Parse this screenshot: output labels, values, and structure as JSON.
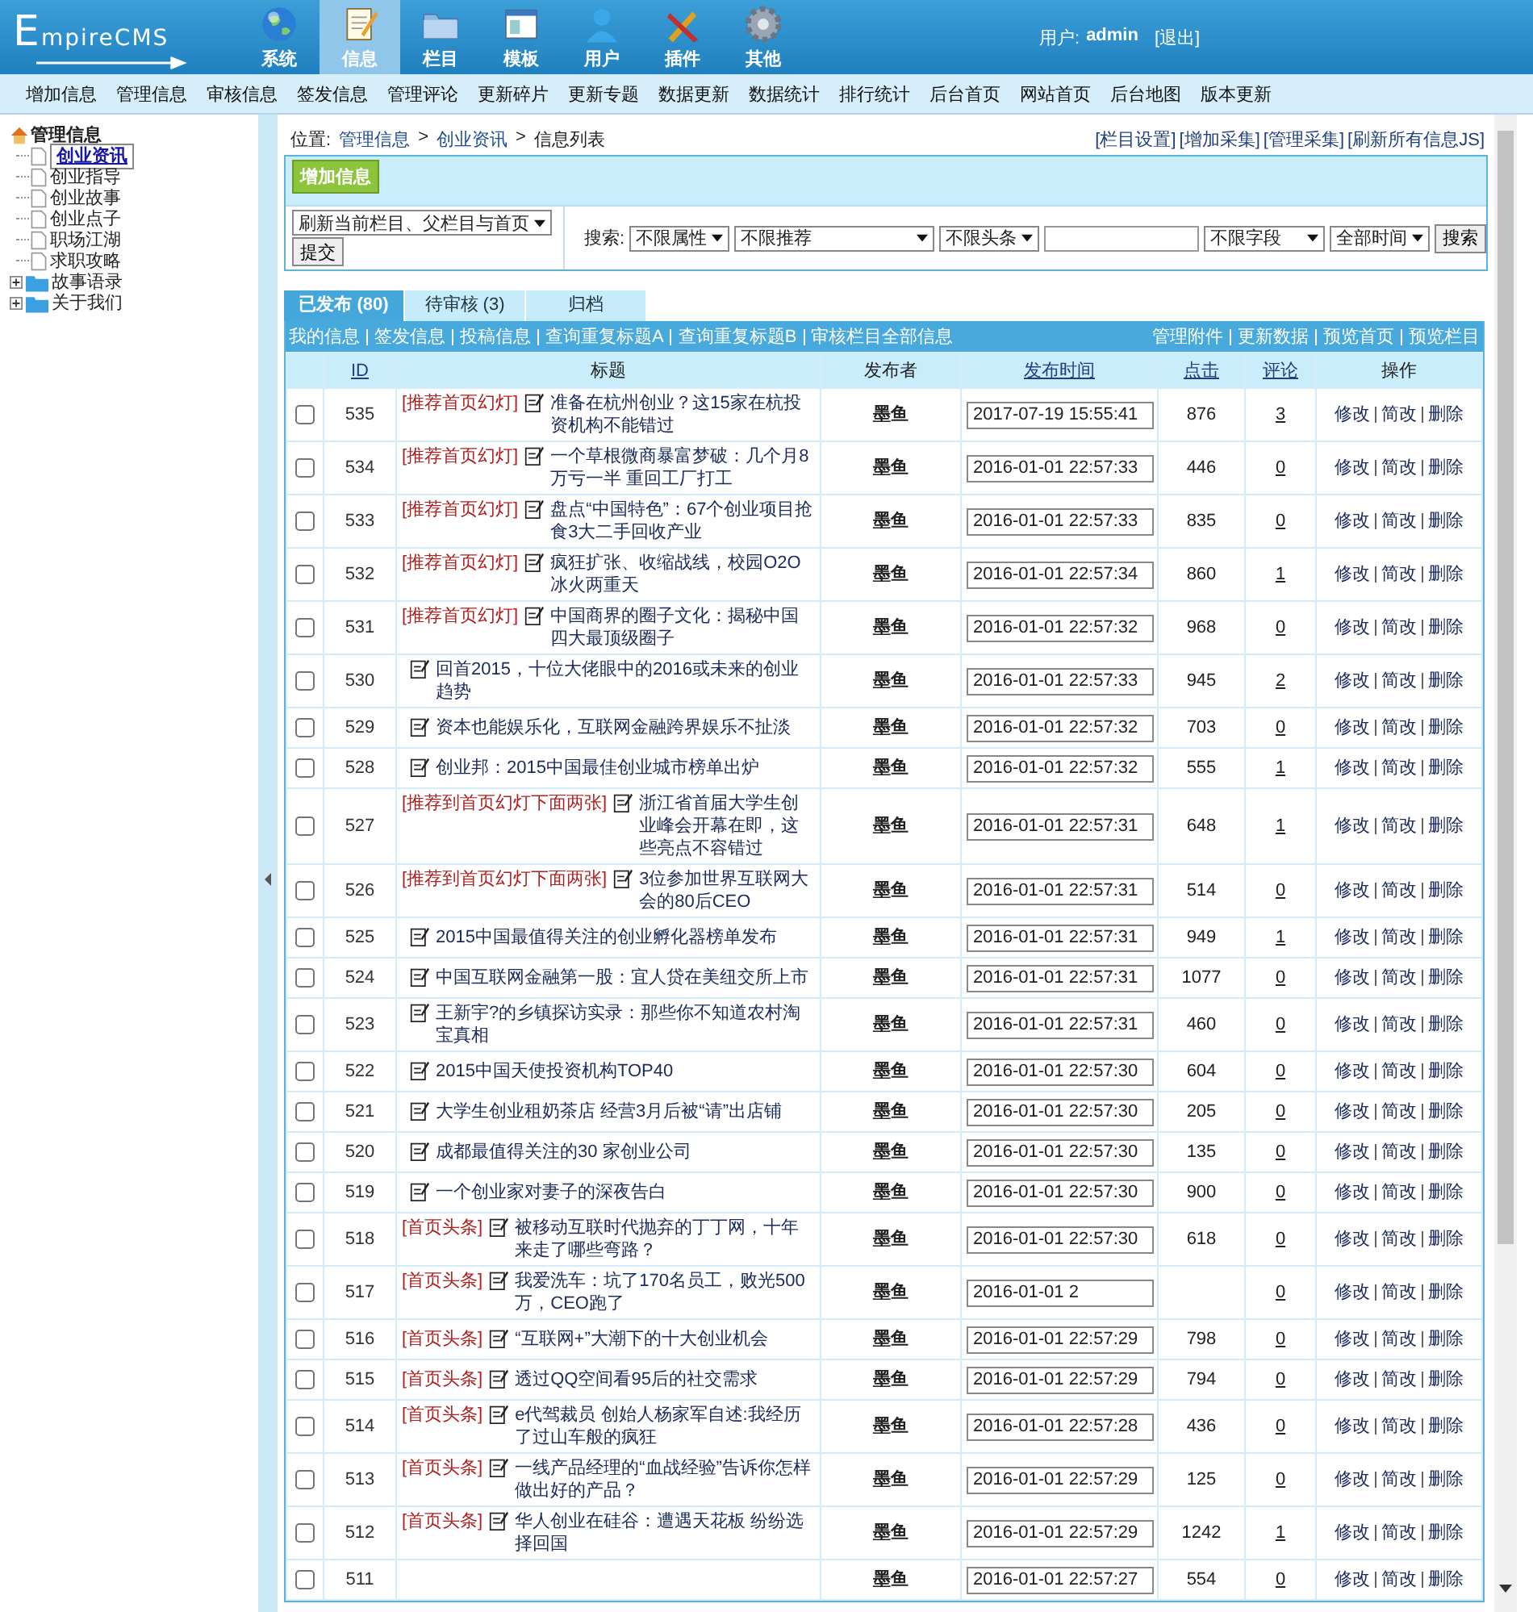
{
  "header": {
    "logo": "EmpireCMS",
    "nav": [
      {
        "label": "系统",
        "selected": false
      },
      {
        "label": "信息",
        "selected": true
      },
      {
        "label": "栏目",
        "selected": false
      },
      {
        "label": "模板",
        "selected": false
      },
      {
        "label": "用户",
        "selected": false
      },
      {
        "label": "插件",
        "selected": false
      },
      {
        "label": "其他",
        "selected": false
      }
    ],
    "user_label": "用户:",
    "user": "admin",
    "logout": "[退出]"
  },
  "menu": [
    "增加信息",
    "管理信息",
    "审核信息",
    "签发信息",
    "管理评论",
    "更新碎片",
    "更新专题",
    "数据更新",
    "数据统计",
    "排行统计",
    "后台首页",
    "网站首页",
    "后台地图",
    "版本更新"
  ],
  "sidebar": {
    "root": "管理信息",
    "children": [
      {
        "label": "创业资讯",
        "selected": true
      },
      {
        "label": "创业指导",
        "selected": false
      },
      {
        "label": "创业故事",
        "selected": false
      },
      {
        "label": "创业点子",
        "selected": false
      },
      {
        "label": "职场江湖",
        "selected": false
      },
      {
        "label": "求职攻略",
        "selected": false
      }
    ],
    "folders": [
      {
        "label": "故事语录",
        "expanded": false
      },
      {
        "label": "关于我们",
        "expanded": false
      }
    ]
  },
  "breadcrumb": {
    "label": "位置:",
    "path": [
      "管理信息",
      "创业资讯",
      "信息列表"
    ],
    "separator": ">"
  },
  "top_links": [
    "[栏目设置]",
    "[增加采集]",
    "[管理采集]",
    "[刷新所有信息JS]"
  ],
  "toolbar": {
    "add_button": "增加信息",
    "refresh_select": "刷新当前栏目、父栏目与首页",
    "submit": "提交",
    "search_label": "搜索:",
    "filters": [
      "不限属性",
      "不限推荐",
      "不限头条"
    ],
    "field_select": "不限字段",
    "time_select": "全部时间",
    "search_button": "搜索"
  },
  "tabs": [
    {
      "label": "已发布 (80)",
      "selected": true
    },
    {
      "label": "待审核 (3)",
      "selected": false
    },
    {
      "label": "归档",
      "selected": false
    }
  ],
  "links_left": [
    "我的信息",
    "签发信息",
    "投稿信息",
    "查询重复标题A",
    "查询重复标题B",
    "审核栏目全部信息"
  ],
  "links_right": [
    "管理附件",
    "更新数据",
    "预览首页",
    "预览栏目"
  ],
  "table": {
    "columns": [
      {
        "label": "ID",
        "sortable": true
      },
      {
        "label": "标题",
        "sortable": false
      },
      {
        "label": "发布者",
        "sortable": false
      },
      {
        "label": "发布时间",
        "sortable": true
      },
      {
        "label": "点击",
        "sortable": true
      },
      {
        "label": "评论",
        "sortable": true
      },
      {
        "label": "操作",
        "sortable": false
      }
    ],
    "rows": [
      {
        "checked": false,
        "id": "535",
        "tag": "[推荐首页幻灯]",
        "title": "准备在杭州创业？这15家在杭投资机构不能错过",
        "publisher": "墨鱼",
        "time": "2017-07-19 15:55:41",
        "clicks": "876",
        "comments": "3",
        "actions": [
          "修改",
          "简改",
          "删除"
        ]
      },
      {
        "checked": false,
        "id": "534",
        "tag": "[推荐首页幻灯]",
        "title": "一个草根微商暴富梦破：几个月8万亏一半 重回工厂打工",
        "publisher": "墨鱼",
        "time": "2016-01-01 22:57:33",
        "clicks": "446",
        "comments": "0",
        "actions": [
          "修改",
          "简改",
          "删除"
        ]
      },
      {
        "checked": false,
        "id": "533",
        "tag": "[推荐首页幻灯]",
        "title": "盘点“中国特色”：67个创业项目抢食3大二手回收产业",
        "publisher": "墨鱼",
        "time": "2016-01-01 22:57:33",
        "clicks": "835",
        "comments": "0",
        "actions": [
          "修改",
          "简改",
          "删除"
        ]
      },
      {
        "checked": false,
        "id": "532",
        "tag": "[推荐首页幻灯]",
        "title": "疯狂扩张、收缩战线，校园O2O冰火两重天",
        "publisher": "墨鱼",
        "time": "2016-01-01 22:57:34",
        "clicks": "860",
        "comments": "1",
        "actions": [
          "修改",
          "简改",
          "删除"
        ]
      },
      {
        "checked": false,
        "id": "531",
        "tag": "[推荐首页幻灯]",
        "title": "中国商界的圈子文化：揭秘中国四大最顶级圈子",
        "publisher": "墨鱼",
        "time": "2016-01-01 22:57:32",
        "clicks": "968",
        "comments": "0",
        "actions": [
          "修改",
          "简改",
          "删除"
        ]
      },
      {
        "checked": false,
        "id": "530",
        "title": "回首2015，十位大佬眼中的2016或未来的创业趋势",
        "publisher": "墨鱼",
        "time": "2016-01-01 22:57:33",
        "clicks": "945",
        "comments": "2",
        "actions": [
          "修改",
          "简改",
          "删除"
        ]
      },
      {
        "checked": false,
        "id": "529",
        "title": "资本也能娱乐化，互联网金融跨界娱乐不扯淡",
        "publisher": "墨鱼",
        "time": "2016-01-01 22:57:32",
        "clicks": "703",
        "comments": "0",
        "actions": [
          "修改",
          "简改",
          "删除"
        ]
      },
      {
        "checked": false,
        "id": "528",
        "title": "创业邦：2015中国最佳创业城市榜单出炉",
        "publisher": "墨鱼",
        "time": "2016-01-01 22:57:32",
        "clicks": "555",
        "comments": "1",
        "actions": [
          "修改",
          "简改",
          "删除"
        ]
      },
      {
        "checked": false,
        "id": "527",
        "tag": "[推荐到首页幻灯下面两张]",
        "title": "浙江省首届大学生创业峰会开幕在即，这些亮点不容错过",
        "publisher": "墨鱼",
        "time": "2016-01-01 22:57:31",
        "clicks": "648",
        "comments": "1",
        "actions": [
          "修改",
          "简改",
          "删除"
        ]
      },
      {
        "checked": false,
        "id": "526",
        "tag": "[推荐到首页幻灯下面两张]",
        "title": "3位参加世界互联网大会的80后CEO",
        "publisher": "墨鱼",
        "time": "2016-01-01 22:57:31",
        "clicks": "514",
        "comments": "0",
        "actions": [
          "修改",
          "简改",
          "删除"
        ]
      },
      {
        "checked": false,
        "id": "525",
        "title": "2015中国最值得关注的创业孵化器榜单发布",
        "publisher": "墨鱼",
        "time": "2016-01-01 22:57:31",
        "clicks": "949",
        "comments": "1",
        "actions": [
          "修改",
          "简改",
          "删除"
        ]
      },
      {
        "checked": false,
        "id": "524",
        "title": "中国互联网金融第一股：宜人贷在美纽交所上市",
        "publisher": "墨鱼",
        "time": "2016-01-01 22:57:31",
        "clicks": "1077",
        "comments": "0",
        "actions": [
          "修改",
          "简改",
          "删除"
        ]
      },
      {
        "checked": false,
        "id": "523",
        "title": "王新宇?的乡镇探访实录：那些你不知道农村淘宝真相",
        "publisher": "墨鱼",
        "time": "2016-01-01 22:57:31",
        "clicks": "460",
        "comments": "0",
        "actions": [
          "修改",
          "简改",
          "删除"
        ]
      },
      {
        "checked": false,
        "id": "522",
        "title": "2015中国天使投资机构TOP40",
        "publisher": "墨鱼",
        "time": "2016-01-01 22:57:30",
        "clicks": "604",
        "comments": "0",
        "actions": [
          "修改",
          "简改",
          "删除"
        ]
      },
      {
        "checked": false,
        "id": "521",
        "title": "大学生创业租奶茶店 经营3月后被“请”出店铺",
        "publisher": "墨鱼",
        "time": "2016-01-01 22:57:30",
        "clicks": "205",
        "comments": "0",
        "actions": [
          "修改",
          "简改",
          "删除"
        ]
      },
      {
        "checked": false,
        "id": "520",
        "title": "成都最值得关注的30 家创业公司",
        "publisher": "墨鱼",
        "time": "2016-01-01 22:57:30",
        "clicks": "135",
        "comments": "0",
        "actions": [
          "修改",
          "简改",
          "删除"
        ]
      },
      {
        "checked": false,
        "id": "519",
        "title": "一个创业家对妻子的深夜告白",
        "publisher": "墨鱼",
        "time": "2016-01-01 22:57:30",
        "clicks": "900",
        "comments": "0",
        "actions": [
          "修改",
          "简改",
          "删除"
        ]
      },
      {
        "checked": false,
        "id": "518",
        "tag": "[首页头条]",
        "title": "被移动互联时代抛弃的丁丁网，十年来走了哪些弯路？",
        "publisher": "墨鱼",
        "time": "2016-01-01 22:57:30",
        "clicks": "618",
        "comments": "0",
        "actions": [
          "修改",
          "简改",
          "删除"
        ]
      },
      {
        "checked": false,
        "id": "517",
        "tag": "[首页头条]",
        "title": "我爱洗车：坑了170名员工，败光500万，CEO跑了",
        "publisher": "墨鱼",
        "time": "2016-01-01 2",
        "comments": "0",
        "actions": [
          "修改",
          "简改",
          "删除"
        ]
      },
      {
        "checked": false,
        "id": "516",
        "tag": "[首页头条]",
        "title": "“互联网+”大潮下的十大创业机会",
        "publisher": "墨鱼",
        "time": "2016-01-01 22:57:29",
        "clicks": "798",
        "comments": "0",
        "actions": [
          "修改",
          "简改",
          "删除"
        ]
      },
      {
        "checked": false,
        "id": "515",
        "tag": "[首页头条]",
        "title": "透过QQ空间看95后的社交需求",
        "publisher": "墨鱼",
        "time": "2016-01-01 22:57:29",
        "clicks": "794",
        "comments": "0",
        "actions": [
          "修改",
          "简改",
          "删除"
        ]
      },
      {
        "checked": false,
        "id": "514",
        "tag": "[首页头条]",
        "title": "e代驾裁员 创始人杨家军自述:我经历了过山车般的疯狂",
        "publisher": "墨鱼",
        "time": "2016-01-01 22:57:28",
        "clicks": "436",
        "comments": "0",
        "actions": [
          "修改",
          "简改",
          "删除"
        ]
      },
      {
        "checked": false,
        "id": "513",
        "tag": "[首页头条]",
        "title": "一线产品经理的“血战经验”告诉你怎样做出好的产品？",
        "publisher": "墨鱼",
        "time": "2016-01-01 22:57:29",
        "clicks": "125",
        "comments": "0",
        "actions": [
          "修改",
          "简改",
          "删除"
        ]
      },
      {
        "checked": false,
        "id": "512",
        "tag": "[首页头条]",
        "title": "华人创业在硅谷：遭遇天花板 纷纷选择回国",
        "publisher": "墨鱼",
        "time": "2016-01-01 22:57:29",
        "clicks": "1242",
        "comments": "1",
        "actions": [
          "修改",
          "简改",
          "删除"
        ]
      },
      {
        "checked": false,
        "id": "511",
        "publisher": "墨鱼",
        "time": "2016-01-01 22:57:27",
        "clicks": "554",
        "comments": "0",
        "actions": [
          "修改",
          "简改",
          "删除"
        ]
      }
    ]
  }
}
